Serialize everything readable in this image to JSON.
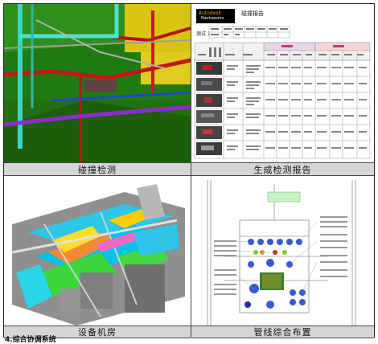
{
  "captions": {
    "top_left": "碰撞检测",
    "top_right": "生成检测报告",
    "bottom_left": "设备机房",
    "bottom_right": "管线综合布置"
  },
  "report": {
    "brand_line1": "Autodesk",
    "brand_line2": "Navisworks",
    "title": "碰撞报告",
    "test_label": "测试 1"
  },
  "footer_note": "4.综合协调系统"
}
